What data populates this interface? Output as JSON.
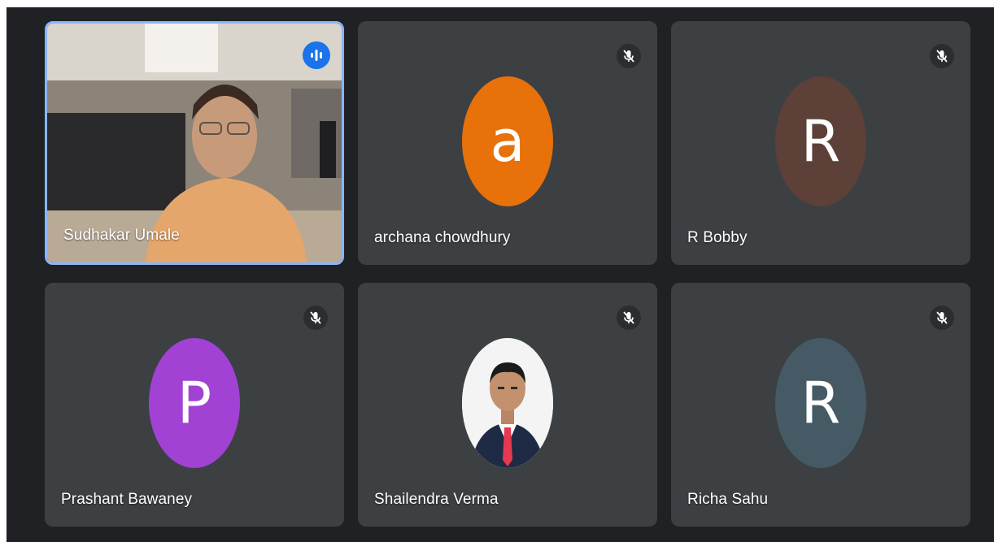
{
  "participants": [
    {
      "name": "Sudhakar Umale",
      "type": "video",
      "speaking": true,
      "icon": "audio-wave-icon"
    },
    {
      "name": "archana chowdhury",
      "type": "avatar",
      "initial": "a",
      "color": "#e8710a",
      "muted": true,
      "icon": "mic-off-icon"
    },
    {
      "name": "R Bobby",
      "type": "avatar",
      "initial": "R",
      "color": "#5d4037",
      "muted": true,
      "icon": "mic-off-icon"
    },
    {
      "name": "Prashant Bawaney",
      "type": "avatar",
      "initial": "P",
      "color": "#a142d4",
      "muted": true,
      "icon": "mic-off-icon"
    },
    {
      "name": "Shailendra Verma",
      "type": "photo",
      "muted": true,
      "icon": "mic-off-icon"
    },
    {
      "name": "Richa Sahu",
      "type": "avatar",
      "initial": "R",
      "color": "#455a64",
      "muted": true,
      "icon": "mic-off-icon"
    }
  ],
  "colors": {
    "background": "#202124",
    "tile": "#3c4043",
    "speaker_border": "#8ab4f8",
    "speaking_badge": "#1a73e8"
  }
}
